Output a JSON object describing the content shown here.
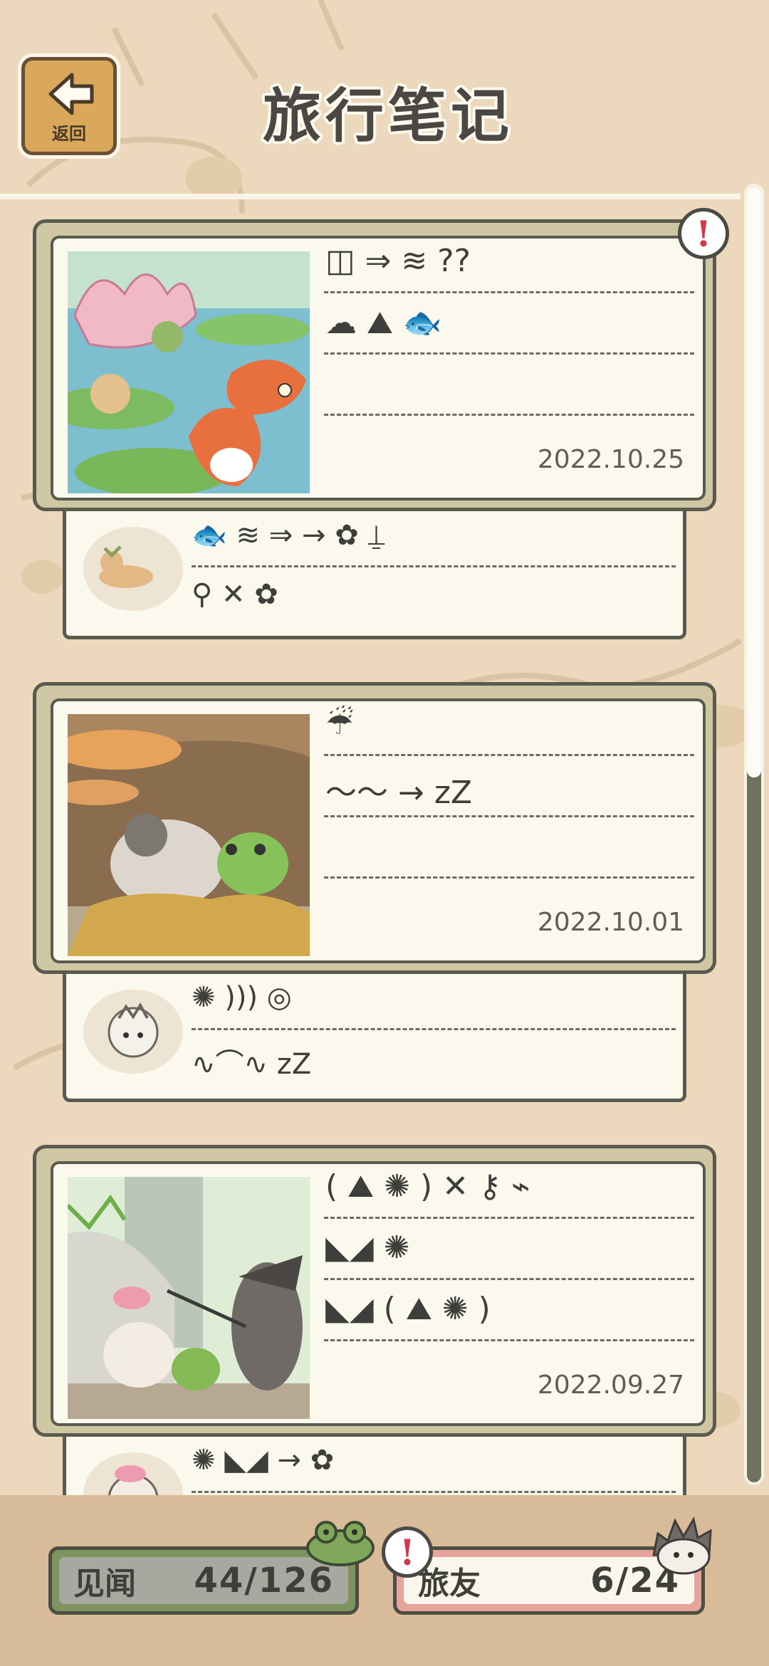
{
  "header": {
    "title": "旅行笔记",
    "back_label": "返回"
  },
  "entries": [
    {
      "date": "2022.10.25",
      "lines": [
        "◫ ⇒ ≋ ??",
        "☁ ⛰ 🐟",
        ""
      ],
      "sub_lines": [
        "🐟 ≋ ⇒ → ✿ ⍊",
        "⚲ ✕ ✿"
      ],
      "has_alert": true
    },
    {
      "date": "2022.10.01",
      "lines": [
        "☔",
        "〜〜 → zZ",
        ""
      ],
      "sub_lines": [
        "✺ ))) ◎",
        "∿⌒∿ zZ"
      ],
      "has_alert": false
    },
    {
      "date": "2022.09.27",
      "lines": [
        "( ⛰ ✺ ) ✕ ⚷ ⌁",
        "◣◢ ✺",
        "◣◢ ( ⛰ ✺ )"
      ],
      "sub_lines": [
        "✺ ◣◢ → ✿"
      ],
      "has_alert": false
    }
  ],
  "footer": {
    "left_label": "见闻",
    "left_value": "44/126",
    "right_label": "旅友",
    "right_value": "6/24"
  },
  "colors": {
    "background": "#ecd9bd",
    "alert_red": "#d1394a",
    "left_counter": "#7e945e",
    "right_counter": "#e6a59b"
  }
}
